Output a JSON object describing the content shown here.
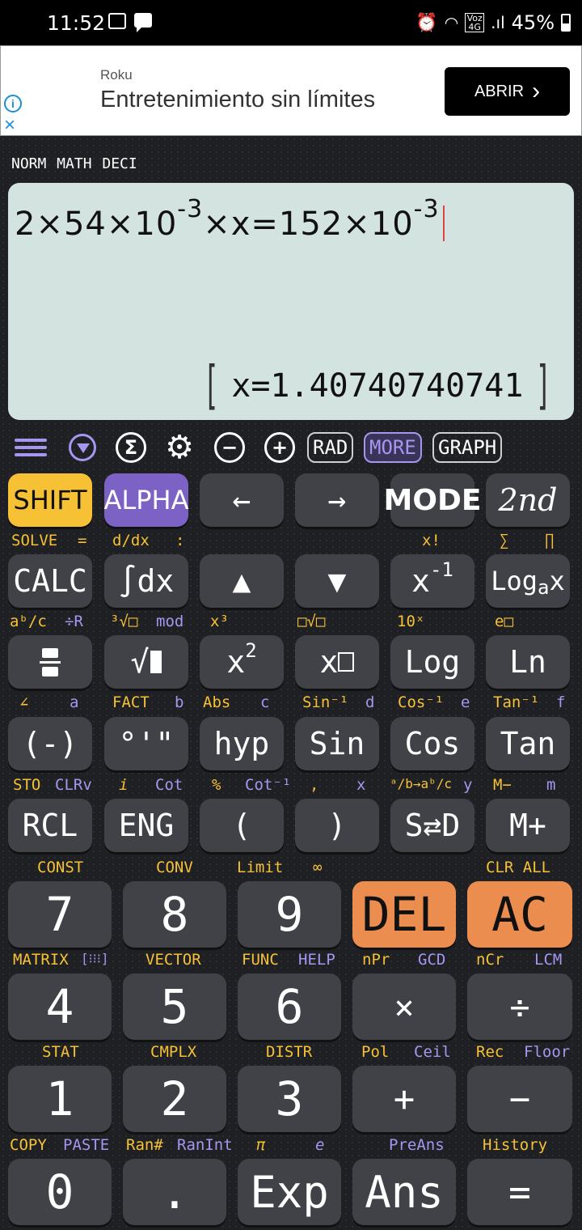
{
  "status": {
    "time": "11:52",
    "battery": "45%",
    "net_label": "Voz 4G",
    "signal_text": ".ıl"
  },
  "ad": {
    "brand": "Roku",
    "headline": "Entretenimiento sin límites",
    "cta": "ABRIR",
    "chevron": "›",
    "info_glyph": "i",
    "close_glyph": "×"
  },
  "modeline": "NORM MATH DECI",
  "display": {
    "expr_a": "2×54×10",
    "exp_a": "-3",
    "expr_b": "×x=152×10",
    "exp_b": "-3",
    "result": "x=1.40740740741",
    "bracket_open": "[",
    "bracket_close": "]"
  },
  "toolbar": {
    "sigma": "Σ",
    "minus": "−",
    "plus": "+",
    "rad": "RAD",
    "more": "MORE",
    "graph": "GRAPH"
  },
  "keys": {
    "shift": "SHIFT",
    "alpha": "ALPHA",
    "left": "←",
    "right": "→",
    "mode": "MODE",
    "second": "2nd",
    "calc": "CALC",
    "integral": "∫dx",
    "up": "▲",
    "down": "▼",
    "inverse_base": "x",
    "inverse_exp": "-1",
    "log_base_a": "Log",
    "log_sub": "a",
    "log_x": "x",
    "sqrt": "√",
    "square_base": "x",
    "square_exp": "2",
    "power_base": "x",
    "log": "Log",
    "ln": "Ln",
    "neg": "(-)",
    "dms": "°'\"",
    "hyp": "hyp",
    "sin": "Sin",
    "cos": "Cos",
    "tan": "Tan",
    "rcl": "RCL",
    "eng": "ENG",
    "lparen": "(",
    "rparen": ")",
    "sd": "S⇄D",
    "mplus": "M+",
    "n7": "7",
    "n8": "8",
    "n9": "9",
    "del": "DEL",
    "ac": "AC",
    "n4": "4",
    "n5": "5",
    "n6": "6",
    "times": "×",
    "divide": "÷",
    "n1": "1",
    "n2": "2",
    "n3": "3",
    "add": "+",
    "sub": "−",
    "n0": "0",
    "dot": ".",
    "exp": "Exp",
    "ans": "Ans",
    "equals": "="
  },
  "labels": {
    "r1": [
      "SOLVE",
      "=",
      "d/dx",
      ":",
      "x!",
      "∑",
      "∏"
    ],
    "r2": [
      "aᵇ/c",
      "÷R",
      "³√□",
      "mod",
      "x³",
      "□√□",
      "10ˣ",
      "e□"
    ],
    "r3": [
      "∠",
      "a",
      "FACT",
      "b",
      "Abs",
      "c",
      "Sin⁻¹",
      "d",
      "Cos⁻¹",
      "e",
      "Tan⁻¹",
      "f"
    ],
    "r4": [
      "STO",
      "CLRv",
      "i",
      "Cot",
      "%",
      "Cot⁻¹",
      ",",
      "x",
      "ᵃ/b→aᵇ/c",
      "y",
      "M−",
      "m"
    ],
    "r5": [
      "CONST",
      "CONV",
      "Limit",
      "∞",
      "CLR ALL"
    ],
    "r6": [
      "MATRIX",
      "[⁝⁝⁝]",
      "VECTOR",
      "FUNC",
      "HELP",
      "nPr",
      "GCD",
      "nCr",
      "LCM"
    ],
    "r7": [
      "STAT",
      "CMPLX",
      "DISTR",
      "Pol",
      "Ceil",
      "Rec",
      "Floor"
    ],
    "r8": [
      "COPY",
      "PASTE",
      "Ran#",
      "RanInt",
      "π",
      "e",
      "PreAns",
      "History"
    ]
  }
}
